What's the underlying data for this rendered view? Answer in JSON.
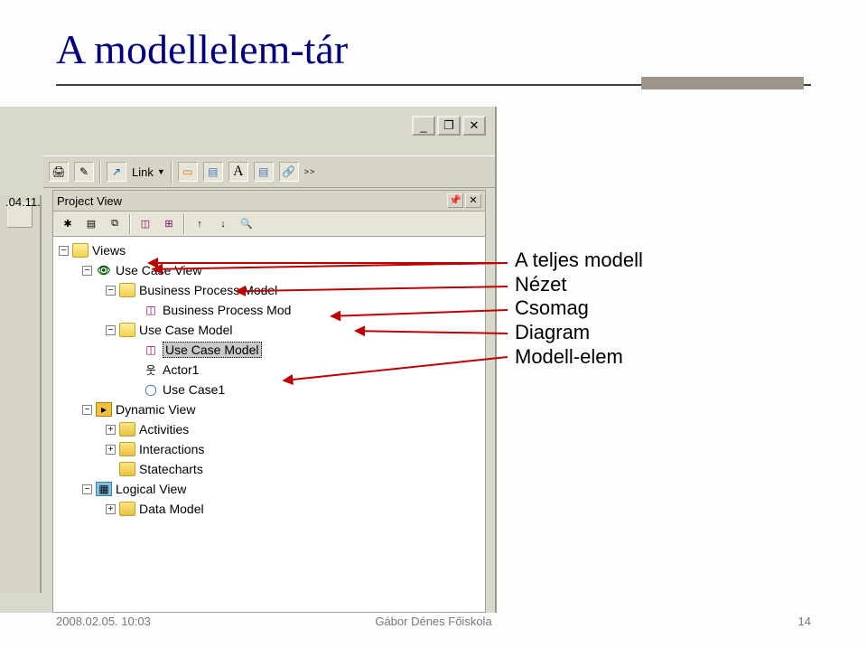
{
  "slide": {
    "title": "A modellelem-tár"
  },
  "annotations": {
    "a1": "A teljes modell",
    "a2": "Nézet",
    "a3": "Csomag",
    "a4": "Diagram",
    "a5": "Modell-elem"
  },
  "win_controls": {
    "minimize": "_",
    "restore": "❐",
    "close": "✕"
  },
  "toolbar": {
    "link_label": "Link",
    "more": ">>"
  },
  "date_fragment": ".04.11.",
  "panel_title": "Project View",
  "panel_hdr": {
    "pin": "📌",
    "close": "✕"
  },
  "tree": {
    "views": "Views",
    "ucv": "Use Case View",
    "bpm": "Business Process Model",
    "bpm_diag": "Business Process Mod",
    "ucm": "Use Case Model",
    "ucm_diag": "Use Case Model",
    "actor1": "Actor1",
    "uc1": "Use Case1",
    "dyn": "Dynamic View",
    "act": "Activities",
    "inter": "Interactions",
    "state": "Statecharts",
    "logical": "Logical View",
    "data": "Data Model"
  },
  "footer": {
    "datetime": "2008.02.05. 10:03",
    "org": "Gábor Dénes Főiskola",
    "page": "14"
  }
}
